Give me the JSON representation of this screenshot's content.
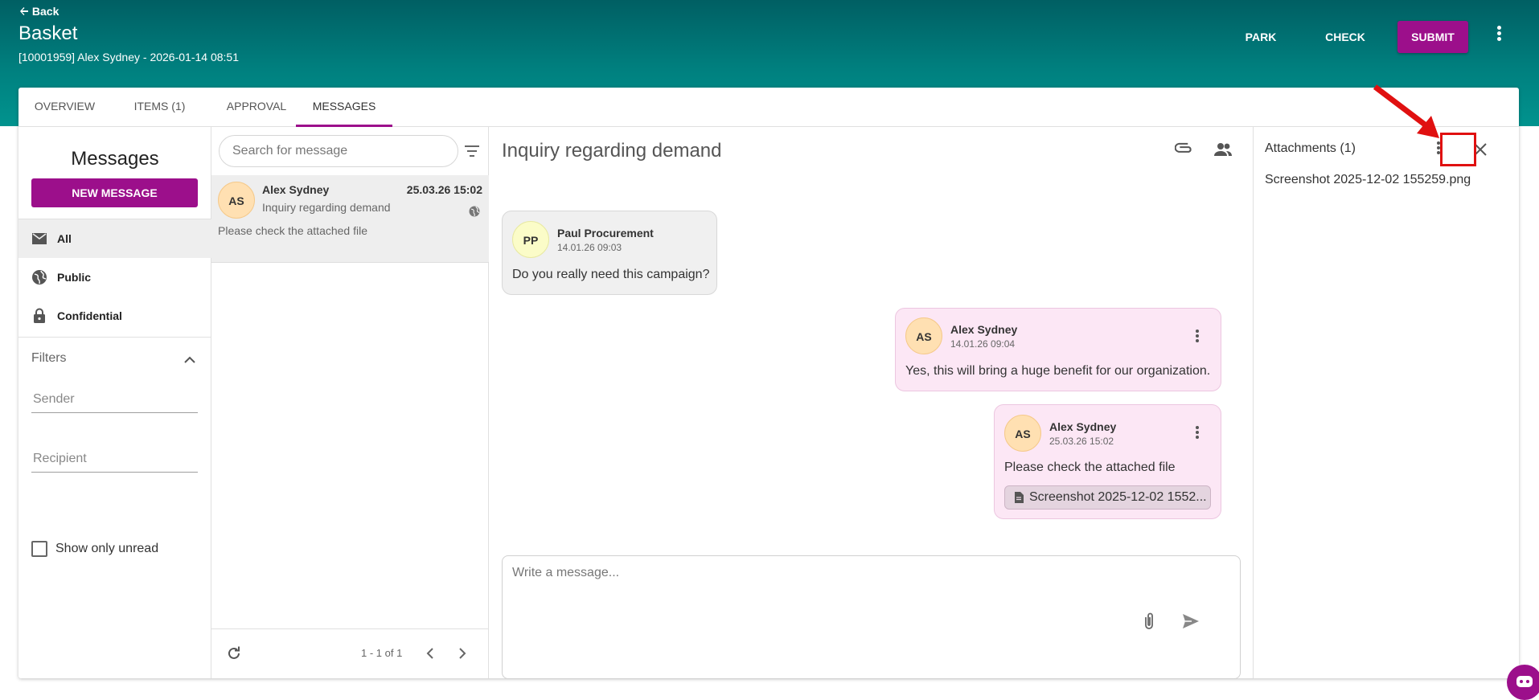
{
  "header": {
    "back_label": "Back",
    "title": "Basket",
    "subtitle": "[10001959] Alex Sydney - 2026-01-14 08:51",
    "park_label": "PARK",
    "check_label": "CHECK",
    "submit_label": "SUBMIT",
    "menu_icon": "more-vert-icon"
  },
  "tabs": [
    {
      "label": "OVERVIEW",
      "active": false
    },
    {
      "label": "ITEMS (1)",
      "active": false
    },
    {
      "label": "APPROVAL",
      "active": false
    },
    {
      "label": "MESSAGES",
      "active": true
    }
  ],
  "sidebar": {
    "heading": "Messages",
    "new_message_label": "NEW MESSAGE",
    "items": [
      {
        "label": "All",
        "icon": "mail-icon",
        "selected": true
      },
      {
        "label": "Public",
        "icon": "globe-icon",
        "selected": false
      },
      {
        "label": "Confidential",
        "icon": "lock-icon",
        "selected": false
      }
    ],
    "filters_label": "Filters",
    "sender_placeholder": "Sender",
    "recipient_placeholder": "Recipient",
    "unread_label": "Show only unread"
  },
  "message_list": {
    "search_placeholder": "Search for message",
    "items": [
      {
        "initials": "AS",
        "name": "Alex Sydney",
        "time": "25.03.26 15:02",
        "subject": "Inquiry regarding demand",
        "preview": "Please check the attached file"
      }
    ],
    "pager_text": "1 - 1 of 1"
  },
  "conversation": {
    "title": "Inquiry regarding demand",
    "messages": [
      {
        "initials": "PP",
        "name": "Paul Procurement",
        "time": "14.01.26 09:03",
        "text": "Do you really need this campaign?"
      },
      {
        "initials": "AS",
        "name": "Alex Sydney",
        "time": "14.01.26 09:04",
        "text": "Yes, this will bring a huge benefit for our organization."
      },
      {
        "initials": "AS",
        "name": "Alex Sydney",
        "time": "25.03.26 15:02",
        "text": "Please check the attached file",
        "attachment": "Screenshot 2025-12-02 1552..."
      }
    ],
    "compose_placeholder": "Write a message..."
  },
  "attachments": {
    "title": "Attachments (1)",
    "files": [
      "Screenshot 2025-12-02 155259.png"
    ]
  },
  "colors": {
    "brand": "#9c0f8b",
    "header_top": "#005f63",
    "header_bottom": "#01938e",
    "highlight": "#e01010"
  }
}
